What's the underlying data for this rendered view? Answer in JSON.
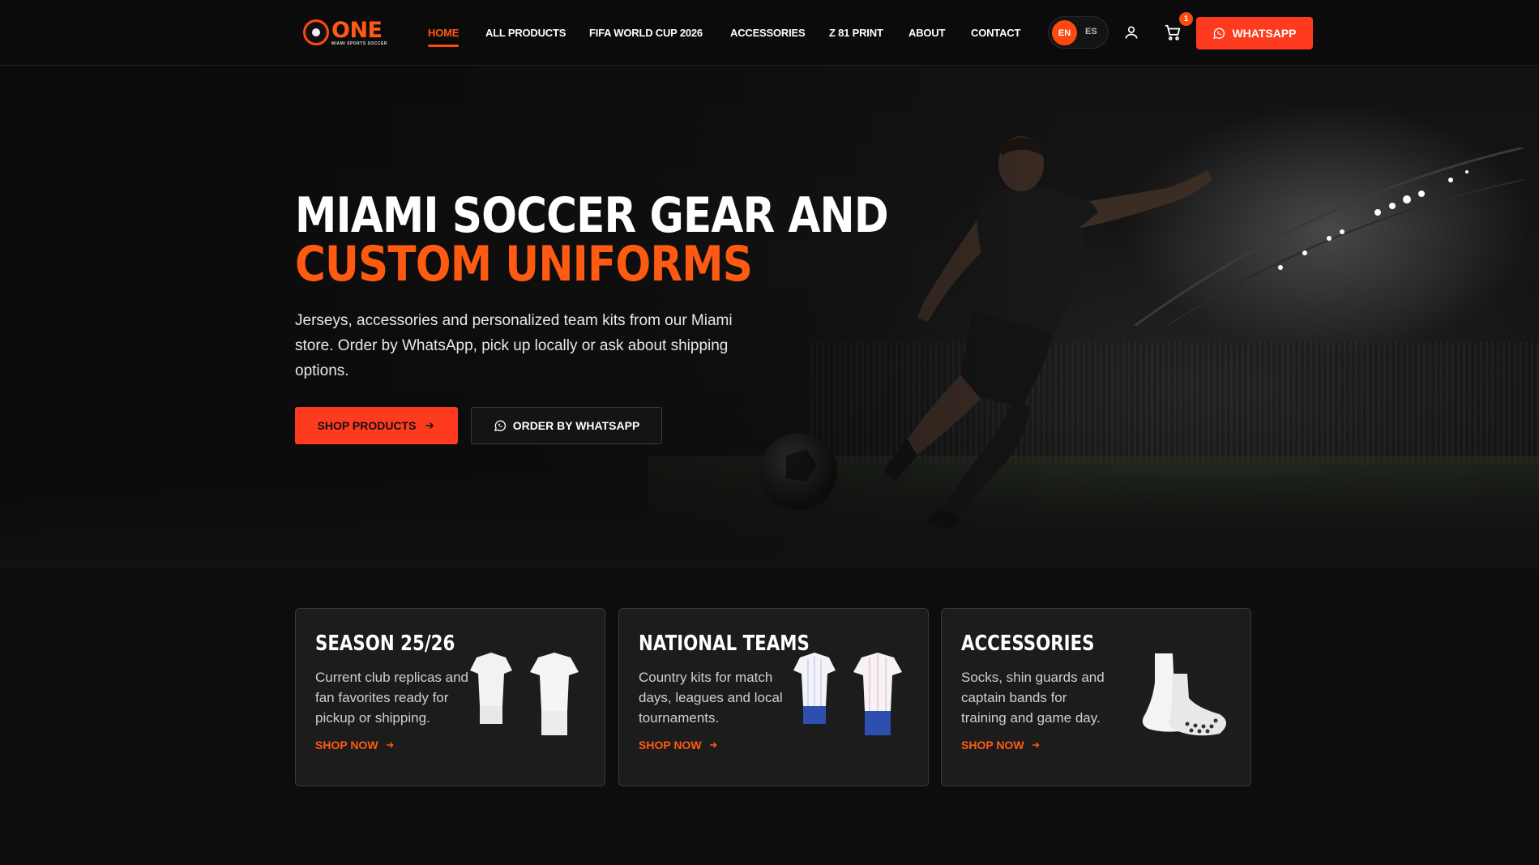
{
  "brand": {
    "name": "ONE",
    "tagline": "MIAMI SPORTS SOCCER",
    "accent": "#ff4a0f"
  },
  "nav": {
    "items": [
      {
        "label": "HOME",
        "active": true
      },
      {
        "label": "ALL PRODUCTS"
      },
      {
        "label": "FIFA WORLD CUP 2026"
      },
      {
        "label": "ACCESSORIES"
      },
      {
        "label": "Z 81 PRINT"
      },
      {
        "label": "ABOUT"
      },
      {
        "label": "CONTACT"
      }
    ]
  },
  "lang": {
    "active": "EN",
    "other": "ES"
  },
  "icons": {
    "account": "user-icon",
    "cart": "cart-icon",
    "whatsapp": "whatsapp-icon",
    "arrow": "arrow-right-icon"
  },
  "cart": {
    "count": "1"
  },
  "header_cta": {
    "label": "WHATSAPP"
  },
  "hero": {
    "title_line1": "MIAMI SOCCER GEAR AND",
    "title_line2": "CUSTOM UNIFORMS",
    "description": "Jerseys, accessories and personalized team kits from our Miami store. Order by WhatsApp, pick up locally or ask about shipping options.",
    "primary_cta": "SHOP PRODUCTS",
    "secondary_cta": "ORDER BY WHATSAPP"
  },
  "cards": [
    {
      "title": "SEASON 25/26",
      "description": "Current club replicas and fan favorites ready for pickup or shipping.",
      "link": "SHOP NOW"
    },
    {
      "title": "NATIONAL TEAMS",
      "description": "Country kits for match days, leagues and local tournaments.",
      "link": "SHOP NOW"
    },
    {
      "title": "ACCESSORIES",
      "description": "Socks, shin guards and captain bands for training and game day.",
      "link": "SHOP NOW"
    }
  ]
}
